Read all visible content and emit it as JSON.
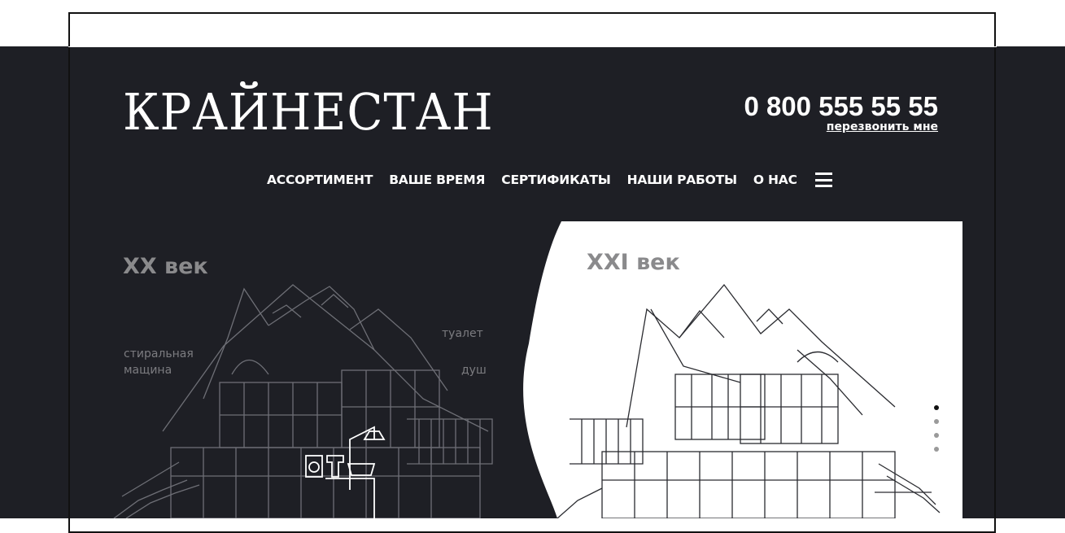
{
  "header": {
    "logo": "КРАЙНЕСТАН",
    "phone": "0 800 555 55 55",
    "callback": "перезвонить мне"
  },
  "nav": {
    "items": [
      "АССОРТИМЕНТ",
      "ВАШЕ ВРЕМЯ",
      "СЕРТИФИКАТЫ",
      "НАШИ РАБОТЫ",
      "О НАС"
    ],
    "menu_icon": "hamburger-icon"
  },
  "hero": {
    "left_title": "XX век",
    "right_title": "XXI век",
    "labels": {
      "washing_machine": "стиральная мащина",
      "toilet": "туалет",
      "shower": "душ"
    },
    "slider": {
      "count": 4,
      "active": 1
    }
  },
  "colors": {
    "dark_background": "#1e1f25",
    "text_white": "#ffffff",
    "muted_gray": "#8a8a8c",
    "panel_white": "#ffffff"
  }
}
